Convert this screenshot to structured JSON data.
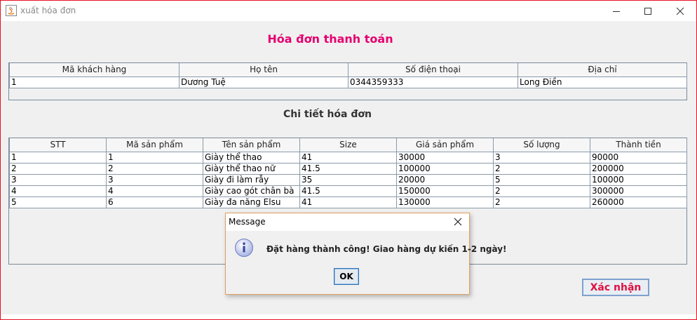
{
  "window": {
    "title": "xuất hóa đơn",
    "border_color": "#e81123"
  },
  "header": {
    "title": "Hóa đơn thanh toán",
    "title_color": "#e6006f"
  },
  "customer_table": {
    "columns": [
      "Mã khách hàng",
      "Họ tên",
      "Số điện thoại",
      "Địa chỉ"
    ],
    "rows": [
      [
        "1",
        "Dương Tuệ",
        "0344359333",
        "Long Điền"
      ]
    ]
  },
  "details": {
    "title": "Chi tiết hóa đơn"
  },
  "details_table": {
    "columns": [
      "STT",
      "Mã sản phẩm",
      "Tên sản phẩm",
      "Size",
      "Giá sản phẩm",
      "Số lượng",
      "Thành tiền"
    ],
    "rows": [
      [
        "1",
        "1",
        "Giày thể thao",
        "41",
        "30000",
        "3",
        "90000"
      ],
      [
        "2",
        "2",
        "Giày thể thao nữ",
        "41.5",
        "100000",
        "2",
        "200000"
      ],
      [
        "3",
        "3",
        "Giày đi làm rẫy",
        "35",
        "20000",
        "5",
        "100000"
      ],
      [
        "4",
        "4",
        "Giày cao gót chân bà",
        "41.5",
        "150000",
        "2",
        "300000"
      ],
      [
        "5",
        "6",
        "Giày đa năng Elsu",
        "41",
        "130000",
        "2",
        "260000"
      ]
    ]
  },
  "actions": {
    "confirm_label": "Xác nhận",
    "confirm_color": "#e01040"
  },
  "dialog": {
    "title": "Message",
    "icon": "info-icon",
    "message": "Đặt hàng thành công! Giao hàng dự kiến 1-2 ngày!",
    "ok_label": "OK"
  }
}
